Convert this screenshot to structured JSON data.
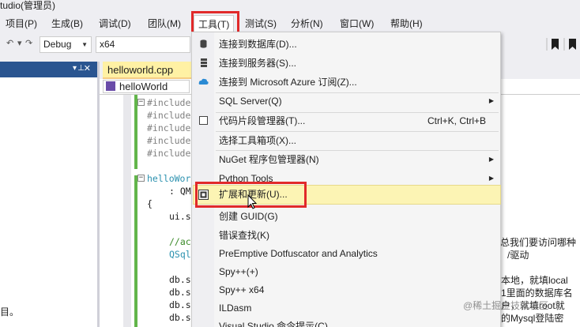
{
  "window": {
    "title": "tudio(管理员)"
  },
  "menu_bar": {
    "items": [
      {
        "label": "项目(P)"
      },
      {
        "label": "生成(B)"
      },
      {
        "label": "调试(D)"
      },
      {
        "label": "团队(M)"
      },
      {
        "label": "工具(T)"
      },
      {
        "label": "测试(S)"
      },
      {
        "label": "分析(N)"
      },
      {
        "label": "窗口(W)"
      },
      {
        "label": "帮助(H)"
      }
    ]
  },
  "toolbar": {
    "config": "Debug",
    "platform": "x64"
  },
  "left_panel": {
    "bottom_text": "目。"
  },
  "editor": {
    "tab_label": "helloworld.cpp",
    "tab_pin": "⊕",
    "scope": "helloWorld",
    "lines": {
      "include_1": "#include",
      "include_2": "#include",
      "include_3": "#include",
      "include_4": "#include",
      "include_5": "#include",
      "ctor": "helloWor",
      "init": ": QM",
      "brace": "{",
      "setup": "ui.s",
      "comment_1": "//ac",
      "qsql": "QSql",
      "db1": "db.s",
      "db2": "db.s",
      "db3": "db.s",
      "db4": "db.s"
    },
    "right_text": {
      "r1": "总我们要访问哪种",
      "r2": "/驱动",
      "r3": "本地，就填local",
      "r4": "1里面的数据库名",
      "r5": "户，就填root就",
      "r6": "的Mysql登陆密"
    }
  },
  "tools_menu": {
    "items": {
      "connect_db": "连接到数据库(D)...",
      "connect_server": "连接到服务器(S)...",
      "connect_azure": "连接到 Microsoft Azure 订阅(Z)...",
      "sql_server": "SQL Server(Q)",
      "snippet_mgr": "代码片段管理器(T)...",
      "snippet_shortcut": "Ctrl+K, Ctrl+B",
      "choose_toolbox": "选择工具箱项(X)...",
      "nuget": "NuGet 程序包管理器(N)",
      "python_tools": "Python Tools",
      "extensions": "扩展和更新(U)...",
      "create_guid": "创建 GUID(G)",
      "error_lookup": "错误查找(K)",
      "dotfuscator": "PreEmptive Dotfuscator and Analytics",
      "spy": "Spy++(+)",
      "spy_x64": "Spy++ x64",
      "ildasm": "ILDasm",
      "vs_cmd": "Visual Studio 命令提示(C)"
    }
  },
  "watermark": "@稀土掘金技术社区"
}
